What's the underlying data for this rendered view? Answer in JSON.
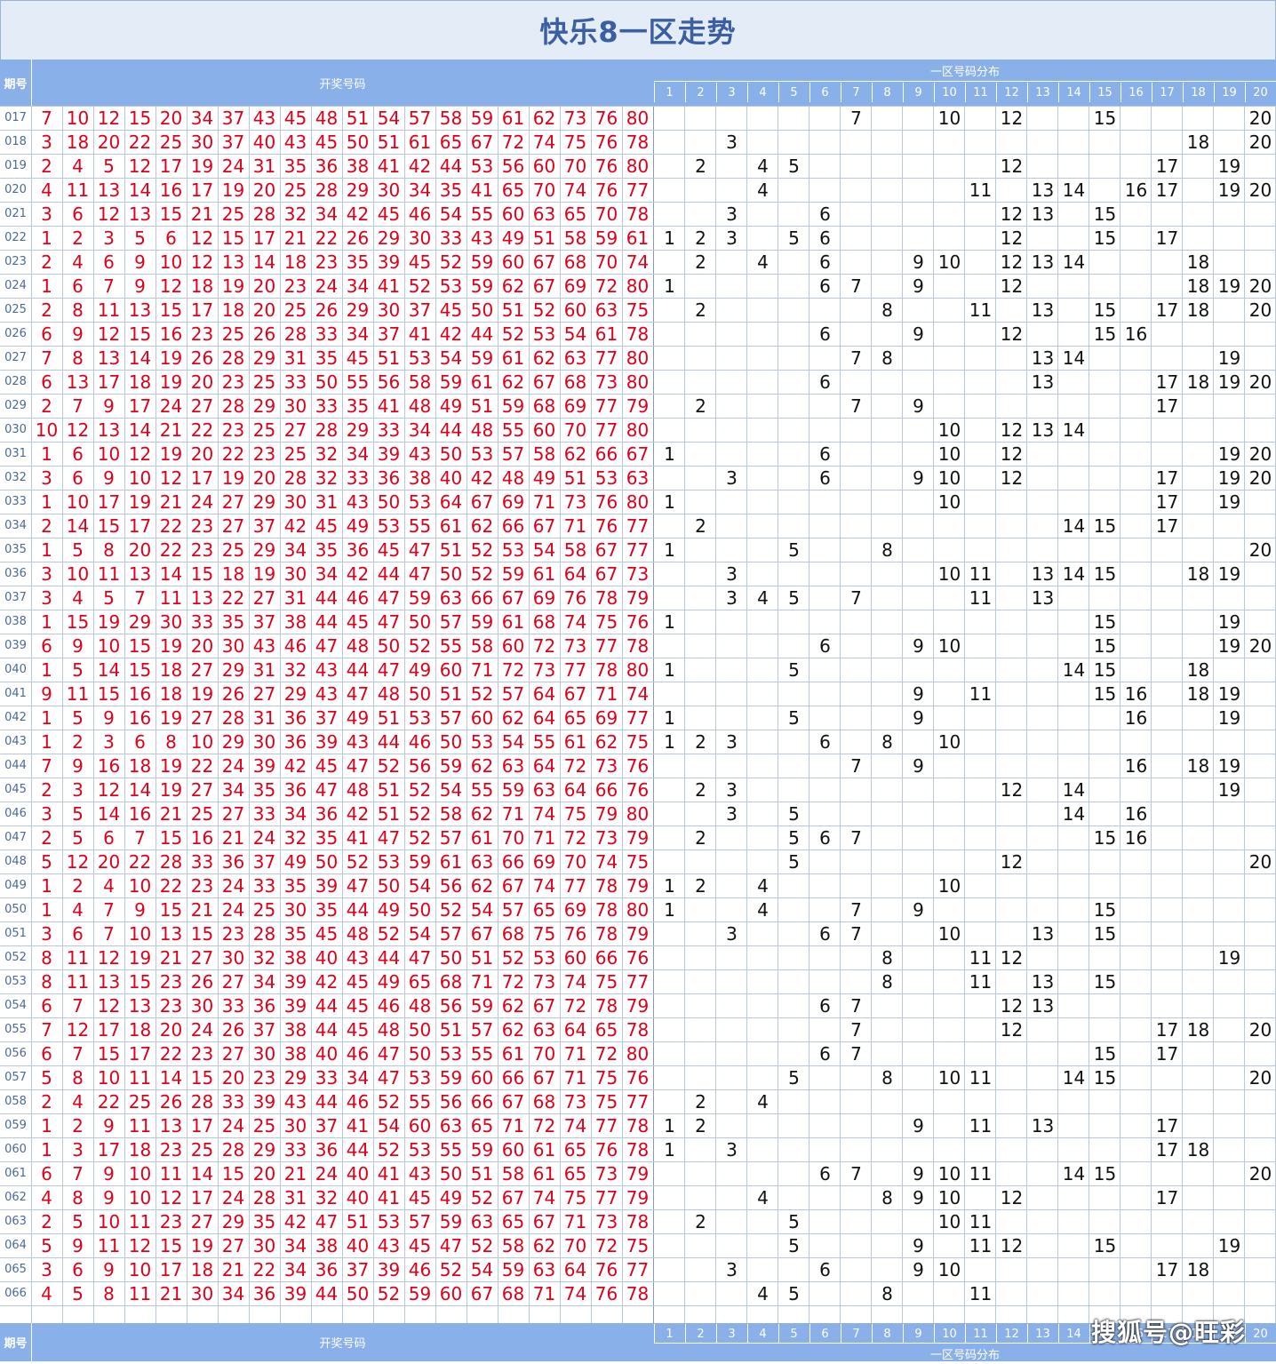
{
  "title": "快乐8一区走势",
  "header": {
    "period_label": "期号",
    "numbers_label": "开奖号码",
    "zone_label": "一区号码分布",
    "zone_columns": [
      "1",
      "2",
      "3",
      "4",
      "5",
      "6",
      "7",
      "8",
      "9",
      "10",
      "11",
      "12",
      "13",
      "14",
      "15",
      "16",
      "17",
      "18",
      "19",
      "20"
    ]
  },
  "watermark": "搜狐号@旺彩",
  "colors": {
    "draw_number": "#e0001a",
    "zone_number": "#111111",
    "header_bg": "#89b0e8",
    "title": "#3a5fa3"
  },
  "chart_data": {
    "type": "table",
    "rows": [
      {
        "period": "017",
        "numbers": [
          7,
          10,
          12,
          15,
          20,
          34,
          37,
          43,
          45,
          48,
          51,
          54,
          57,
          58,
          59,
          61,
          62,
          73,
          76,
          80
        ]
      },
      {
        "period": "018",
        "numbers": [
          3,
          18,
          20,
          22,
          25,
          30,
          37,
          40,
          43,
          45,
          50,
          51,
          61,
          65,
          67,
          72,
          74,
          75,
          76,
          78
        ]
      },
      {
        "period": "019",
        "numbers": [
          2,
          4,
          5,
          12,
          17,
          19,
          24,
          31,
          35,
          36,
          38,
          41,
          42,
          44,
          53,
          56,
          60,
          70,
          76,
          80
        ]
      },
      {
        "period": "020",
        "numbers": [
          4,
          11,
          13,
          14,
          16,
          17,
          19,
          20,
          25,
          28,
          29,
          30,
          34,
          35,
          41,
          65,
          70,
          74,
          76,
          77
        ]
      },
      {
        "period": "021",
        "numbers": [
          3,
          6,
          12,
          13,
          15,
          21,
          25,
          28,
          32,
          34,
          42,
          45,
          46,
          54,
          55,
          60,
          63,
          65,
          70,
          78
        ]
      },
      {
        "period": "022",
        "numbers": [
          1,
          2,
          3,
          5,
          6,
          12,
          15,
          17,
          21,
          22,
          26,
          29,
          30,
          33,
          43,
          49,
          51,
          58,
          59,
          61
        ]
      },
      {
        "period": "023",
        "numbers": [
          2,
          4,
          6,
          9,
          10,
          12,
          13,
          14,
          18,
          23,
          35,
          39,
          45,
          52,
          59,
          60,
          67,
          68,
          70,
          74
        ]
      },
      {
        "period": "024",
        "numbers": [
          1,
          6,
          7,
          9,
          12,
          18,
          19,
          20,
          23,
          24,
          34,
          41,
          52,
          53,
          59,
          62,
          67,
          69,
          72,
          80
        ]
      },
      {
        "period": "025",
        "numbers": [
          2,
          8,
          11,
          13,
          15,
          17,
          18,
          20,
          25,
          26,
          29,
          30,
          37,
          45,
          50,
          51,
          52,
          60,
          63,
          75
        ]
      },
      {
        "period": "026",
        "numbers": [
          6,
          9,
          12,
          15,
          16,
          23,
          25,
          26,
          28,
          33,
          34,
          37,
          41,
          42,
          44,
          52,
          53,
          54,
          61,
          78
        ]
      },
      {
        "period": "027",
        "numbers": [
          7,
          8,
          13,
          14,
          19,
          26,
          28,
          29,
          31,
          35,
          45,
          51,
          53,
          54,
          59,
          61,
          62,
          63,
          77,
          80
        ]
      },
      {
        "period": "028",
        "numbers": [
          6,
          13,
          17,
          18,
          19,
          20,
          23,
          25,
          33,
          50,
          55,
          56,
          58,
          59,
          61,
          62,
          67,
          68,
          73,
          80
        ]
      },
      {
        "period": "029",
        "numbers": [
          2,
          7,
          9,
          17,
          24,
          27,
          28,
          29,
          30,
          33,
          35,
          41,
          48,
          49,
          51,
          59,
          68,
          69,
          77,
          79
        ]
      },
      {
        "period": "030",
        "numbers": [
          10,
          12,
          13,
          14,
          21,
          22,
          23,
          25,
          27,
          28,
          29,
          33,
          34,
          44,
          48,
          55,
          60,
          70,
          77,
          80
        ]
      },
      {
        "period": "031",
        "numbers": [
          1,
          6,
          10,
          12,
          19,
          20,
          22,
          23,
          25,
          32,
          34,
          39,
          43,
          50,
          53,
          57,
          58,
          62,
          66,
          67
        ]
      },
      {
        "period": "032",
        "numbers": [
          3,
          6,
          9,
          10,
          12,
          17,
          19,
          20,
          28,
          32,
          33,
          36,
          38,
          40,
          42,
          48,
          49,
          51,
          53,
          63
        ]
      },
      {
        "period": "033",
        "numbers": [
          1,
          10,
          17,
          19,
          21,
          24,
          27,
          29,
          30,
          31,
          43,
          50,
          53,
          64,
          67,
          69,
          71,
          73,
          76,
          80
        ]
      },
      {
        "period": "034",
        "numbers": [
          2,
          14,
          15,
          17,
          22,
          23,
          27,
          37,
          42,
          45,
          49,
          53,
          55,
          61,
          62,
          66,
          67,
          71,
          76,
          77
        ]
      },
      {
        "period": "035",
        "numbers": [
          1,
          5,
          8,
          20,
          22,
          23,
          25,
          29,
          34,
          35,
          36,
          45,
          47,
          51,
          52,
          53,
          54,
          58,
          67,
          77
        ]
      },
      {
        "period": "036",
        "numbers": [
          3,
          10,
          11,
          13,
          14,
          15,
          18,
          19,
          30,
          34,
          42,
          44,
          47,
          50,
          52,
          59,
          61,
          64,
          67,
          73
        ]
      },
      {
        "period": "037",
        "numbers": [
          3,
          4,
          5,
          7,
          11,
          13,
          22,
          27,
          31,
          44,
          46,
          47,
          59,
          63,
          66,
          67,
          69,
          76,
          78,
          79
        ]
      },
      {
        "period": "038",
        "numbers": [
          1,
          15,
          19,
          29,
          30,
          33,
          35,
          37,
          38,
          44,
          45,
          47,
          50,
          57,
          59,
          61,
          68,
          74,
          75,
          76
        ]
      },
      {
        "period": "039",
        "numbers": [
          6,
          9,
          10,
          15,
          19,
          20,
          30,
          43,
          46,
          47,
          48,
          50,
          52,
          55,
          58,
          60,
          72,
          73,
          77,
          78
        ]
      },
      {
        "period": "040",
        "numbers": [
          1,
          5,
          14,
          15,
          18,
          27,
          29,
          31,
          32,
          43,
          44,
          47,
          49,
          60,
          71,
          72,
          73,
          77,
          78,
          80
        ]
      },
      {
        "period": "041",
        "numbers": [
          9,
          11,
          15,
          16,
          18,
          19,
          26,
          27,
          29,
          43,
          47,
          48,
          50,
          51,
          52,
          57,
          64,
          67,
          71,
          74
        ]
      },
      {
        "period": "042",
        "numbers": [
          1,
          5,
          9,
          16,
          19,
          27,
          28,
          31,
          36,
          37,
          49,
          51,
          53,
          57,
          60,
          62,
          64,
          65,
          69,
          77
        ]
      },
      {
        "period": "043",
        "numbers": [
          1,
          2,
          3,
          6,
          8,
          10,
          29,
          30,
          36,
          39,
          43,
          44,
          46,
          50,
          53,
          54,
          55,
          61,
          62,
          75
        ]
      },
      {
        "period": "044",
        "numbers": [
          7,
          9,
          16,
          18,
          19,
          22,
          24,
          39,
          42,
          45,
          47,
          52,
          56,
          59,
          62,
          63,
          64,
          72,
          73,
          76
        ]
      },
      {
        "period": "045",
        "numbers": [
          2,
          3,
          12,
          14,
          19,
          27,
          34,
          35,
          36,
          47,
          48,
          51,
          52,
          54,
          55,
          59,
          63,
          64,
          66,
          76
        ]
      },
      {
        "period": "046",
        "numbers": [
          3,
          5,
          14,
          16,
          21,
          25,
          27,
          33,
          34,
          36,
          42,
          51,
          52,
          58,
          62,
          71,
          74,
          75,
          79,
          80
        ]
      },
      {
        "period": "047",
        "numbers": [
          2,
          5,
          6,
          7,
          15,
          16,
          21,
          24,
          32,
          35,
          41,
          47,
          52,
          57,
          61,
          70,
          71,
          72,
          73,
          79
        ]
      },
      {
        "period": "048",
        "numbers": [
          5,
          12,
          20,
          22,
          28,
          33,
          36,
          37,
          49,
          50,
          52,
          53,
          59,
          61,
          63,
          66,
          69,
          70,
          74,
          75
        ]
      },
      {
        "period": "049",
        "numbers": [
          1,
          2,
          4,
          10,
          22,
          23,
          24,
          33,
          35,
          39,
          47,
          50,
          54,
          56,
          62,
          67,
          74,
          77,
          78,
          79
        ]
      },
      {
        "period": "050",
        "numbers": [
          1,
          4,
          7,
          9,
          15,
          21,
          24,
          25,
          30,
          35,
          44,
          49,
          50,
          52,
          54,
          57,
          65,
          69,
          78,
          80
        ]
      },
      {
        "period": "051",
        "numbers": [
          3,
          6,
          7,
          10,
          13,
          15,
          23,
          28,
          35,
          45,
          48,
          52,
          54,
          57,
          67,
          68,
          75,
          76,
          78,
          79
        ]
      },
      {
        "period": "052",
        "numbers": [
          8,
          11,
          12,
          19,
          21,
          27,
          30,
          32,
          38,
          40,
          43,
          44,
          47,
          50,
          51,
          52,
          53,
          60,
          66,
          76
        ]
      },
      {
        "period": "053",
        "numbers": [
          8,
          11,
          13,
          15,
          23,
          26,
          27,
          34,
          39,
          42,
          45,
          49,
          65,
          68,
          71,
          72,
          73,
          74,
          75,
          77
        ]
      },
      {
        "period": "054",
        "numbers": [
          6,
          7,
          12,
          13,
          23,
          30,
          33,
          36,
          39,
          44,
          45,
          46,
          48,
          56,
          59,
          62,
          67,
          72,
          78,
          79
        ]
      },
      {
        "period": "055",
        "numbers": [
          7,
          12,
          17,
          18,
          20,
          24,
          26,
          37,
          38,
          44,
          45,
          48,
          50,
          51,
          57,
          62,
          63,
          64,
          65,
          78
        ]
      },
      {
        "period": "056",
        "numbers": [
          6,
          7,
          15,
          17,
          22,
          23,
          27,
          30,
          38,
          40,
          46,
          47,
          50,
          53,
          55,
          61,
          70,
          71,
          72,
          80
        ]
      },
      {
        "period": "057",
        "numbers": [
          5,
          8,
          10,
          11,
          14,
          15,
          20,
          23,
          29,
          33,
          34,
          47,
          53,
          59,
          60,
          66,
          67,
          71,
          75,
          76
        ]
      },
      {
        "period": "058",
        "numbers": [
          2,
          4,
          22,
          25,
          26,
          28,
          33,
          39,
          43,
          44,
          46,
          52,
          55,
          56,
          66,
          67,
          68,
          73,
          75,
          77
        ]
      },
      {
        "period": "059",
        "numbers": [
          1,
          2,
          9,
          11,
          13,
          17,
          24,
          25,
          30,
          37,
          41,
          54,
          60,
          63,
          65,
          71,
          72,
          74,
          77,
          78
        ]
      },
      {
        "period": "060",
        "numbers": [
          1,
          3,
          17,
          18,
          23,
          25,
          28,
          29,
          33,
          36,
          44,
          52,
          53,
          55,
          59,
          60,
          61,
          65,
          76,
          78
        ]
      },
      {
        "period": "061",
        "numbers": [
          6,
          7,
          9,
          10,
          11,
          14,
          15,
          20,
          21,
          24,
          40,
          41,
          43,
          50,
          51,
          58,
          61,
          65,
          73,
          79
        ]
      },
      {
        "period": "062",
        "numbers": [
          4,
          8,
          9,
          10,
          12,
          17,
          24,
          28,
          31,
          32,
          40,
          41,
          45,
          49,
          52,
          67,
          74,
          75,
          77,
          79
        ]
      },
      {
        "period": "063",
        "numbers": [
          2,
          5,
          10,
          11,
          23,
          27,
          29,
          35,
          42,
          47,
          51,
          53,
          57,
          59,
          63,
          65,
          67,
          71,
          73,
          78
        ]
      },
      {
        "period": "064",
        "numbers": [
          5,
          9,
          11,
          12,
          15,
          19,
          27,
          30,
          34,
          38,
          40,
          43,
          45,
          47,
          52,
          58,
          62,
          70,
          72,
          75
        ]
      },
      {
        "period": "065",
        "numbers": [
          3,
          6,
          9,
          10,
          17,
          18,
          21,
          22,
          34,
          36,
          37,
          39,
          46,
          52,
          54,
          59,
          63,
          64,
          76,
          77
        ]
      },
      {
        "period": "066",
        "numbers": [
          4,
          5,
          8,
          11,
          21,
          30,
          34,
          36,
          39,
          44,
          50,
          52,
          59,
          60,
          67,
          68,
          71,
          74,
          76,
          78
        ]
      }
    ]
  }
}
